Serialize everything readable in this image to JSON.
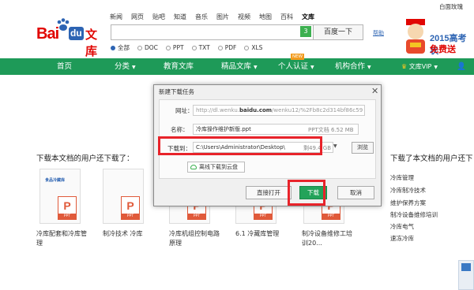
{
  "header": {
    "user_link": "白面玫瑰",
    "logo": {
      "bai": "Bai",
      "du": "du",
      "wenku": "文库"
    },
    "nav_links": [
      "新闻",
      "网页",
      "贴吧",
      "知道",
      "音乐",
      "图片",
      "视频",
      "地图",
      "百科",
      "文库"
    ],
    "search_count": "3",
    "search_button": "百度一下",
    "help": "帮助",
    "file_types": [
      "全部",
      "DOC",
      "PPT",
      "TXT",
      "PDF",
      "XLS"
    ],
    "promo_line1": "2015高考状",
    "promo_line2": "免费送"
  },
  "main_nav": {
    "items": [
      "首页",
      "分类",
      "教育文库",
      "精品文库",
      "个人认证",
      "机构合作",
      "文库VIP"
    ],
    "new_badge": "NEW"
  },
  "section": {
    "left_title": "下载本文档的用户还下载了：",
    "right_title": "下载了本文档的用户还下",
    "docs": [
      {
        "name": "冷库配套和冷库管理",
        "badge": "PPT"
      },
      {
        "name": "制冷技术 冷库",
        "badge": "PPT"
      },
      {
        "name": "冷库机组控制电路原理",
        "badge": "PPT"
      },
      {
        "name": "6.1 冷藏库管理",
        "badge": "PPT"
      },
      {
        "name": "制冷设备维修工培训20...",
        "badge": "PPT"
      }
    ],
    "thumb_caption": "食品冷藏库",
    "right_links": [
      "冷库管理",
      "冷库制冷技术",
      "维护保养方案",
      "制冷设备维修培训",
      "冷库电气",
      "速冻冷库"
    ]
  },
  "dialog": {
    "title": "新建下载任务",
    "url_label": "网址：",
    "url_prefix": "http://dl.wenku.",
    "url_bold": "baidu.com",
    "url_suffix": "/wenku12/%2Fb8c2d314bf86c59",
    "name_label": "名称：",
    "file_name": "冷库操作维护新版.ppt",
    "file_meta": "PPT文档 6.52 MB",
    "dl_label": "下载到：",
    "path": "C:\\Users\\Administrator\\Desktop\\",
    "free_space": "剩49.4 GB",
    "browse": "浏览",
    "cloud": "离线下载到云盘",
    "open_direct": "直接打开",
    "download": "下载",
    "cancel": "取消"
  },
  "colors": {
    "nav_green": "#1e9a58",
    "brand_red": "#e10602",
    "brand_blue": "#2d64b3",
    "highlight": "#e8232a"
  }
}
